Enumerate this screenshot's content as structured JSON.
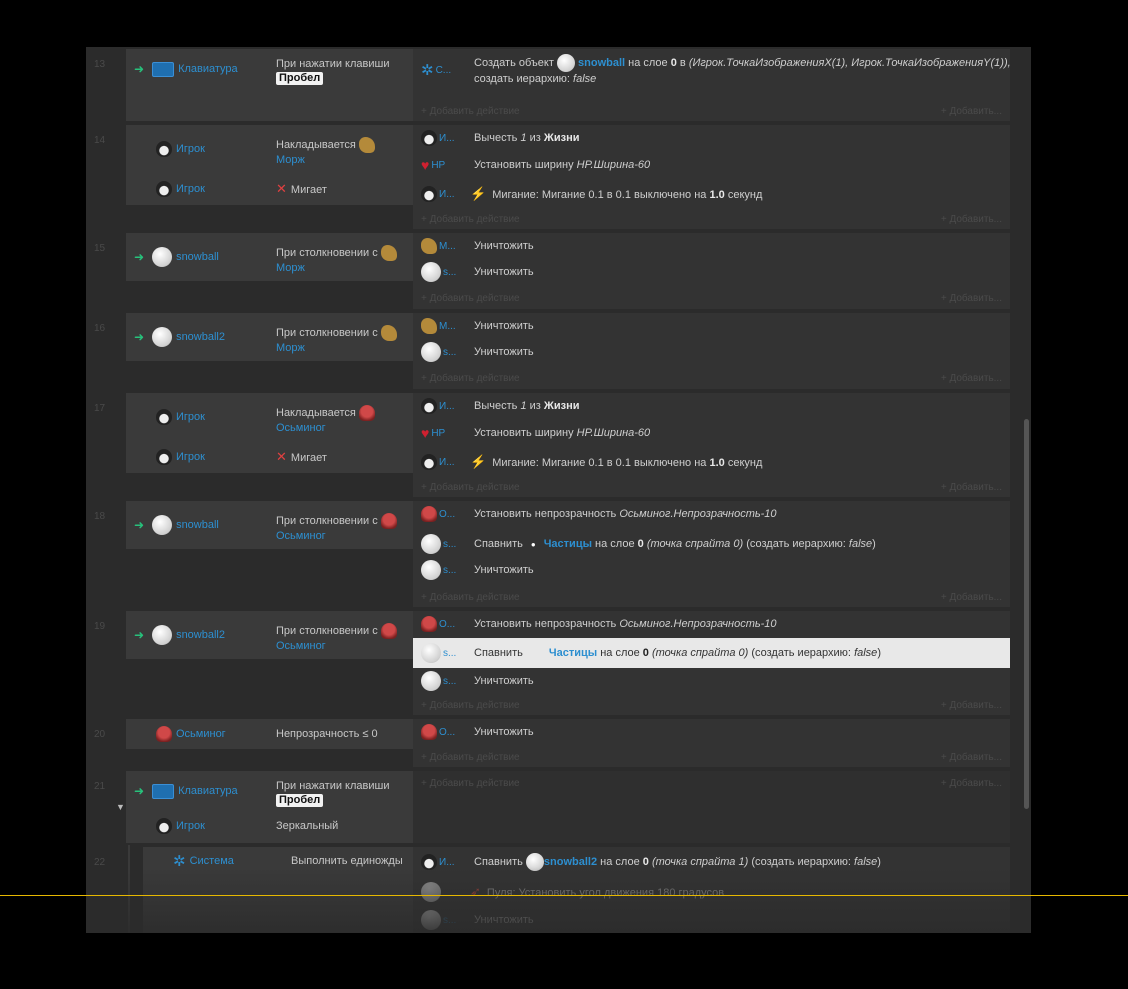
{
  "add_action": "+ Добавить действие",
  "add_right": "+ Добавить...",
  "events": [
    {
      "num": "13",
      "conditions": [
        {
          "object": "Клавиатура",
          "line1": "При нажатии клавиши",
          "key": "Пробел"
        }
      ],
      "actions": [
        {
          "obj": "С...",
          "text_pre": "Создать объект",
          "link": "snowball",
          "text_mid": "на слое",
          "bold": "0",
          "text_post": "в",
          "italic": "(Игрок.ТочкаИзображенияX(1), Игрок.ТочкаИзображенияY(1)),",
          "line2_pre": "создать иерархию:",
          "line2_italic": "false"
        }
      ]
    },
    {
      "num": "14",
      "conditions": [
        {
          "object": "Игрок",
          "line1": "Накладывается",
          "line2": "Морж"
        },
        {
          "object": "Игрок",
          "line1": "Мигает"
        }
      ],
      "actions": [
        {
          "obj": "И...",
          "pre": "Вычесть",
          "italic": "1",
          "mid": "из",
          "bold": "Жизни"
        },
        {
          "obj": "HP",
          "pre": "Установить ширину",
          "italic": "HP.Ширина-60"
        },
        {
          "obj": "И...",
          "pre": "Мигание: Мигание 0.1 в 0.1 выключено на",
          "bold": "1.0",
          "post": "секунд"
        }
      ]
    },
    {
      "num": "15",
      "conditions": [
        {
          "object": "snowball",
          "line1": "При столкновении с",
          "line2": "Морж"
        }
      ],
      "actions": [
        {
          "obj": "М...",
          "text": "Уничтожить"
        },
        {
          "obj": "s...",
          "text": "Уничтожить"
        }
      ]
    },
    {
      "num": "16",
      "conditions": [
        {
          "object": "snowball2",
          "line1": "При столкновении с",
          "line2": "Морж"
        }
      ],
      "actions": [
        {
          "obj": "М...",
          "text": "Уничтожить"
        },
        {
          "obj": "s...",
          "text": "Уничтожить"
        }
      ]
    },
    {
      "num": "17",
      "conditions": [
        {
          "object": "Игрок",
          "line1": "Накладывается",
          "line2": "Осьминог"
        },
        {
          "object": "Игрок",
          "line1": "Мигает"
        }
      ],
      "actions": [
        {
          "obj": "И...",
          "pre": "Вычесть",
          "italic": "1",
          "mid": "из",
          "bold": "Жизни"
        },
        {
          "obj": "HP",
          "pre": "Установить ширину",
          "italic": "HP.Ширина-60"
        },
        {
          "obj": "И...",
          "pre": "Мигание: Мигание 0.1 в 0.1 выключено на",
          "bold": "1.0",
          "post": "секунд"
        }
      ]
    },
    {
      "num": "18",
      "conditions": [
        {
          "object": "snowball",
          "line1": "При столкновении с",
          "line2": "Осьминог"
        }
      ],
      "actions": [
        {
          "obj": "О...",
          "pre": "Установить непрозрачность",
          "italic": "Осьминог.Непрозрачность-10"
        },
        {
          "obj": "s...",
          "pre": "Спавнить",
          "link": "Частицы",
          "mid": "на слое",
          "bold": "0",
          "italic": "(точка спрайта 0)",
          "post": "(создать иерархию:",
          "italic2": "false",
          "end": ")"
        },
        {
          "obj": "s...",
          "text": "Уничтожить"
        }
      ]
    },
    {
      "num": "19",
      "conditions": [
        {
          "object": "snowball2",
          "line1": "При столкновении с",
          "line2": "Осьминог"
        }
      ],
      "actions": [
        {
          "obj": "О...",
          "pre": "Установить непрозрачность",
          "italic": "Осьминог.Непрозрачность-10"
        },
        {
          "obj": "s...",
          "pre": "Спавнить",
          "link": "Частицы",
          "mid": "на слое",
          "bold": "0",
          "italic": "(точка спрайта 0)",
          "post": "(создать иерархию:",
          "italic2": "false",
          "end": ")"
        },
        {
          "obj": "s...",
          "text": "Уничтожить"
        }
      ]
    },
    {
      "num": "20",
      "conditions": [
        {
          "object": "Осьминог",
          "line1": "Непрозрачность ≤ 0"
        }
      ],
      "actions": [
        {
          "obj": "О...",
          "text": "Уничтожить"
        }
      ]
    },
    {
      "num": "21",
      "conditions": [
        {
          "object": "Клавиатура",
          "line1": "При нажатии клавиши",
          "key": "Пробел"
        },
        {
          "object": "Игрок",
          "line1": "Зеркальный"
        }
      ],
      "actions": []
    },
    {
      "num": "22",
      "conditions": [
        {
          "object": "Система",
          "line1": "Выполнить единожды"
        }
      ],
      "actions": [
        {
          "obj": "И...",
          "pre": "Спавнить",
          "link": "snowball2",
          "mid": "на слое",
          "bold": "0",
          "italic": "(точка спрайта 1)",
          "post": "(создать иерархию:",
          "italic2": "false",
          "end": ")"
        },
        {
          "obj": "",
          "text": "Пуля: Установить угол движения 180 градусов"
        },
        {
          "obj": "s...",
          "text": "Уничтожить"
        }
      ]
    }
  ]
}
